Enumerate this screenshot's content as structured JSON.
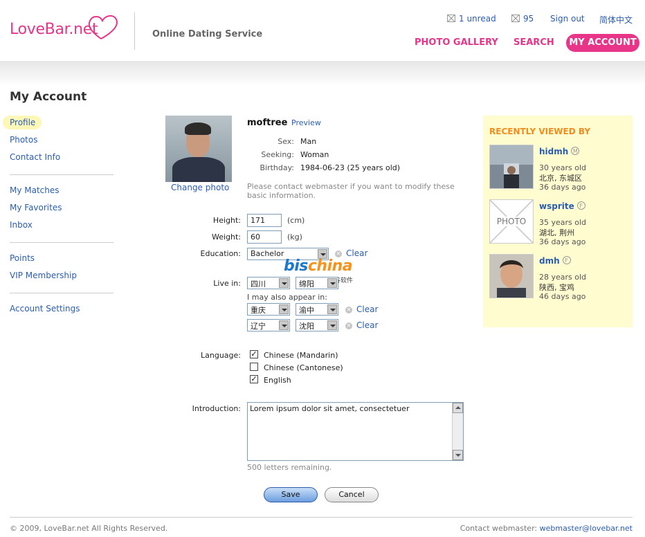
{
  "header": {
    "logo_text": "LoveBar.net",
    "tagline": "Online Dating Service",
    "unread": "1 unread",
    "count": "95",
    "sign_out": "Sign out",
    "language": "简体中文",
    "nav": [
      "PHOTO GALLERY",
      "SEARCH",
      "MY ACCOUNT"
    ]
  },
  "page_title": "My Account",
  "sidebar": {
    "group1": [
      "Profile",
      "Photos",
      "Contact Info"
    ],
    "group2": [
      "My Matches",
      "My Favorites",
      "Inbox"
    ],
    "group3": [
      "Points",
      "VIP Membership"
    ],
    "group4": [
      "Account Settings"
    ]
  },
  "profile": {
    "change_photo": "Change photo",
    "username": "moftree",
    "preview": "Preview",
    "sex_label": "Sex:",
    "sex": "Man",
    "seeking_label": "Seeking:",
    "seeking": "Woman",
    "birthday_label": "Birthday:",
    "birthday": "1984-06-23 (25 years old)",
    "notice": "Please contact webmaster if you want to modify these basic information."
  },
  "form": {
    "height_label": "Height:",
    "height": "171",
    "height_unit": "(cm)",
    "weight_label": "Weight:",
    "weight": "60",
    "weight_unit": "(kg)",
    "education_label": "Education:",
    "education": "Bachelor",
    "clear": "Clear",
    "live_label": "Live in:",
    "live_province": "四川",
    "live_city": "绵阳",
    "also_appear": "I may also appear in:",
    "also1_province": "重庆",
    "also1_city": "渝中",
    "also2_province": "辽宁",
    "also2_city": "沈阳",
    "language_label": "Language:",
    "languages": [
      {
        "label": "Chinese (Mandarin)",
        "checked": "✓"
      },
      {
        "label": "Chinese (Cantonese)",
        "checked": ""
      },
      {
        "label": "English",
        "checked": "✓"
      }
    ],
    "intro_label": "Introduction:",
    "intro": "Lorem ipsum dolor sit amet, consectetuer",
    "remaining": "500 letters remaining.",
    "save": "Save",
    "cancel": "Cancel"
  },
  "watermark": {
    "text_a": "bis",
    "text_b": "china",
    "sub": "斯谷软件"
  },
  "recent": {
    "title": "RECENTLY VIEWED BY",
    "photo_placeholder": "PHOTO",
    "people": [
      {
        "name": "hidmh",
        "badge": "M",
        "age": "30 years old",
        "location": "北京, 东城区",
        "ago": "36 days ago"
      },
      {
        "name": "wsprite",
        "badge": "F",
        "age": "35 years old",
        "location": "湖北, 荆州",
        "ago": "36 days ago"
      },
      {
        "name": "dmh",
        "badge": "F",
        "age": "28 years old",
        "location": "陕西, 宝鸡",
        "ago": "46 days ago"
      }
    ]
  },
  "footer": {
    "copyright": "© 2009, LoveBar.net All Rights Reserved.",
    "contact_label": "Contact webmaster:",
    "email": "webmaster@lovebar.net"
  },
  "colors": {
    "brand_pink": "#e8358a",
    "link_blue": "#2a5db0",
    "orange": "#f28c1e",
    "panel_yellow": "#fffccf"
  }
}
